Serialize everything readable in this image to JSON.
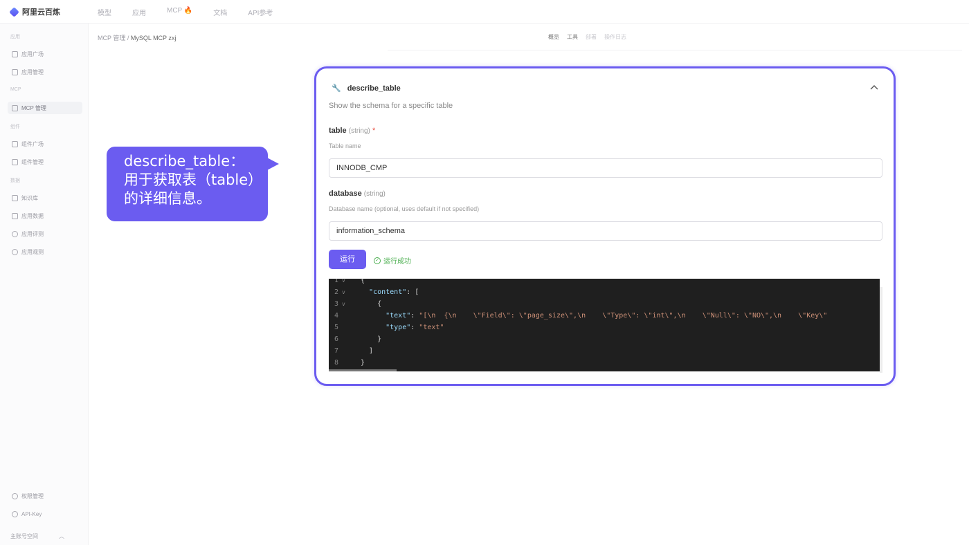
{
  "app": {
    "brand": "阿里云百炼"
  },
  "topnav": [
    "模型",
    "应用",
    "MCP 🔥",
    "文档",
    "API参考"
  ],
  "sidebar": {
    "sections": [
      {
        "label": "应用",
        "items": [
          "应用广场",
          "应用管理"
        ]
      },
      {
        "label": "MCP",
        "items": [
          "MCP 管理"
        ]
      },
      {
        "label": "组件",
        "items": [
          "组件广场",
          "组件管理"
        ]
      },
      {
        "label": "数据",
        "items": [
          "知识库",
          "应用数据",
          "应用评测",
          "应用观测"
        ]
      }
    ],
    "bottom": [
      "权限管理",
      "API-Key"
    ],
    "footer": "主账号空间"
  },
  "breadcrumb": {
    "parent": "MCP 管理",
    "sep": "/",
    "current": "MySQL MCP zxj"
  },
  "tabs": [
    "概览",
    "工具",
    "部署",
    "操作日志"
  ],
  "tool": {
    "name": "describe_table",
    "description": "Show the schema for a specific table",
    "fields": [
      {
        "name": "table",
        "type": "(string)",
        "required": "*",
        "desc": "Table name",
        "value": "INNODB_CMP"
      },
      {
        "name": "database",
        "type": "(string)",
        "required": "",
        "desc": "Database name (optional, uses default if not specified)",
        "value": "information_schema"
      }
    ],
    "run_label": "运行",
    "status": "运行成功"
  },
  "code": {
    "lines": [
      {
        "n": "1",
        "fold": "v",
        "text": "{"
      },
      {
        "n": "2",
        "fold": "v",
        "text": "  \"content\": ["
      },
      {
        "n": "3",
        "fold": "v",
        "text": "    {"
      },
      {
        "n": "4",
        "fold": "",
        "text": "      \"text\": \"[\\n  {\\n    \\\"Field\\\": \\\"page_size\\\",\\n    \\\"Type\\\": \\\"int\\\",\\n    \\\"Null\\\": \\\"NO\\\",\\n    \\\"Key\\\""
      },
      {
        "n": "5",
        "fold": "",
        "text": "      \"type\": \"text\""
      },
      {
        "n": "6",
        "fold": "",
        "text": "    }"
      },
      {
        "n": "7",
        "fold": "",
        "text": "  ]"
      },
      {
        "n": "8",
        "fold": "",
        "text": "}"
      }
    ]
  },
  "callout": {
    "line1": "describe_table：",
    "line2": "用于获取表（table）",
    "line3": "的详细信息。"
  },
  "colors": {
    "accent": "#6b5cf0",
    "success": "#4caf50",
    "code_bg": "#1f1f1f"
  }
}
